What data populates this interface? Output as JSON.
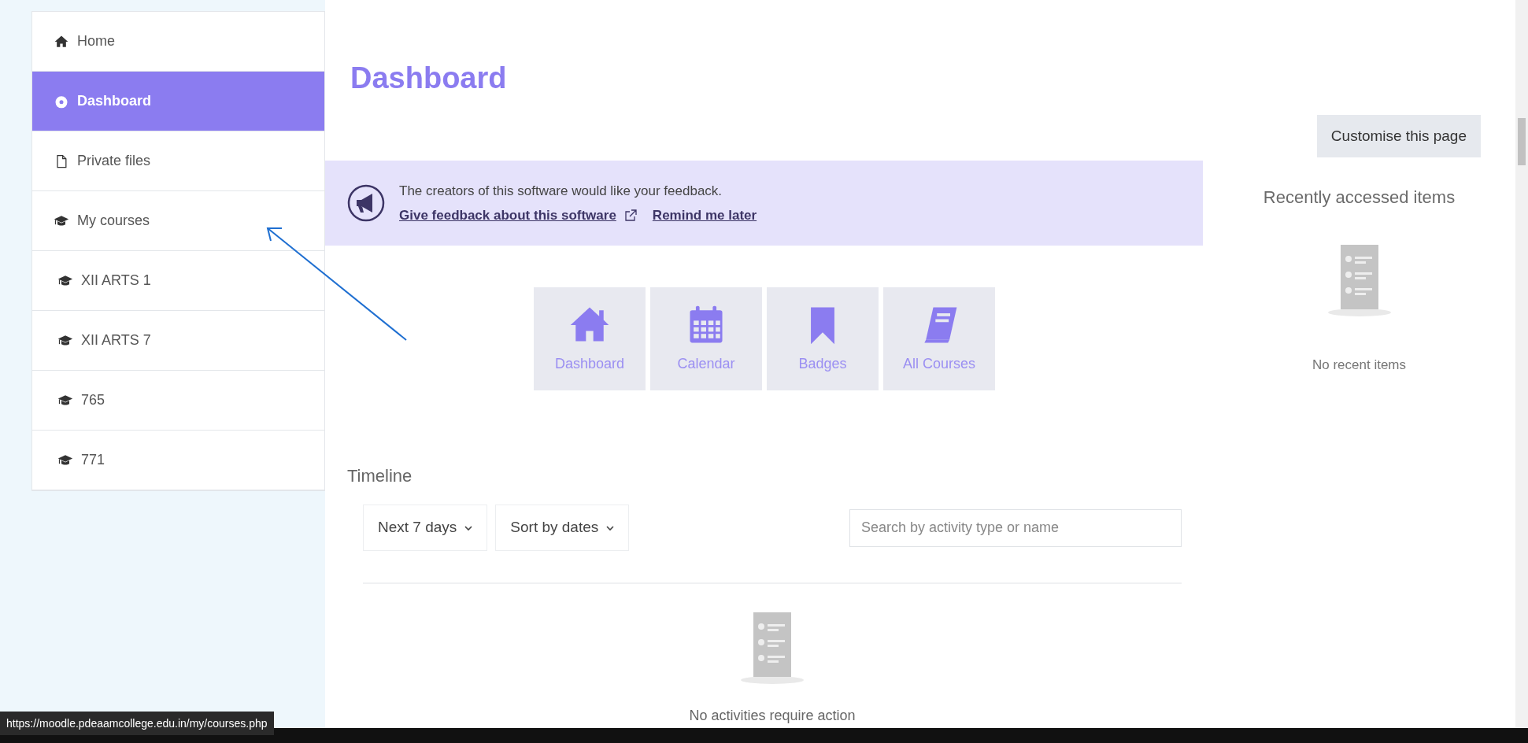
{
  "nav": [
    {
      "label": "Home",
      "kind": "home",
      "selected": false
    },
    {
      "label": "Dashboard",
      "kind": "dashboard",
      "selected": true
    },
    {
      "label": "Private files",
      "kind": "file",
      "selected": false
    },
    {
      "label": "My courses",
      "kind": "course",
      "selected": false,
      "children": [
        {
          "label": "XII ARTS 1",
          "kind": "course",
          "selected": false
        },
        {
          "label": "XII ARTS 7",
          "kind": "course",
          "selected": false
        },
        {
          "label": "765",
          "kind": "course",
          "selected": false
        },
        {
          "label": "771",
          "kind": "course",
          "selected": false
        }
      ]
    }
  ],
  "page_title": "Dashboard",
  "feedback": {
    "message": "The creators of this software would like your feedback.",
    "links": [
      "Give feedback about this software",
      "Remind me later"
    ]
  },
  "tiles": [
    {
      "label": "Dashboard",
      "kind": "home"
    },
    {
      "label": "Calendar",
      "kind": "calendar"
    },
    {
      "label": "Badges",
      "kind": "badges"
    },
    {
      "label": "All Courses",
      "kind": "courses"
    }
  ],
  "timeline": {
    "title": "Timeline",
    "filters": [
      "Next 7 days",
      "Sort by dates"
    ],
    "search": {
      "placeholder": "Search by activity type or name"
    },
    "empty": "No activities require action"
  },
  "customise_button": "Customise this page",
  "recent": {
    "title": "Recently accessed items",
    "empty": "No recent items"
  },
  "status_url": "https://moodle.pdeaamcollege.edu.in/my/courses.php"
}
